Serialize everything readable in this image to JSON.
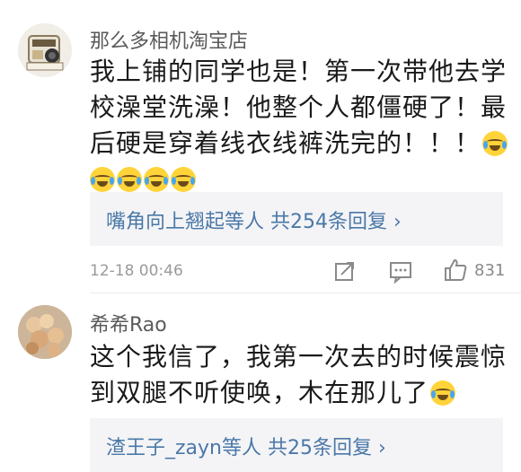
{
  "comments": [
    {
      "username": "那么多相机淘宝店",
      "avatar_icon": "retro-camera-icon",
      "text_lines": [
        "我上铺的同学也是！第一次带他去学",
        "校澡堂洗澡！他整个人都僵硬了！最",
        "后硬是穿着线衣线裤洗完的！！！"
      ],
      "emoji_name": "laughing-tears-emoji",
      "reply_summary": "嘴角向上翘起等人 共254条回复",
      "timestamp": "12-18 00:46",
      "like_count": "831"
    },
    {
      "username": "希希Rao",
      "avatar_icon": "food-photo-avatar",
      "text_lines": [
        "这个我信了，我第一次去的时候震惊",
        "到双腿不听使唤，木在那儿了"
      ],
      "emoji_name": "laughing-tears-emoji",
      "reply_summary": "渣王子_zayn等人 共25条回复"
    }
  ],
  "reply_arrow": "›",
  "colors": {
    "link": "#4a78a8",
    "meta": "#9a9a9a",
    "reply_bg": "#f4f4f6"
  }
}
